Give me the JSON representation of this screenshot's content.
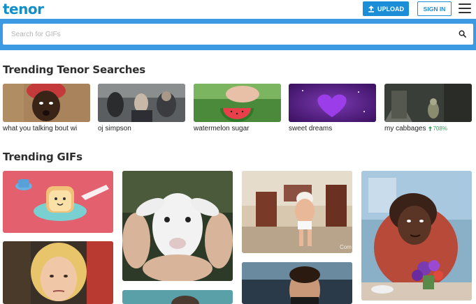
{
  "header": {
    "logo": "tenor",
    "upload_label": "UPLOAD",
    "signin_label": "SIGN IN"
  },
  "search": {
    "placeholder": "Search for GIFs"
  },
  "sections": {
    "trending_searches_title": "Trending Tenor Searches",
    "trending_gifs_title": "Trending GIFs"
  },
  "trending_searches": [
    {
      "label": "what you talking bout wi"
    },
    {
      "label": "oj simpson"
    },
    {
      "label": "watermelon sugar"
    },
    {
      "label": "sweet dreams"
    },
    {
      "label": "my cabbages",
      "trend": "708%"
    }
  ],
  "gif_watermark": "Com",
  "colors": {
    "brand": "#138fc8",
    "accent": "#1c8ed8",
    "search_band": "#3b9ae1",
    "trend_green": "#2aa44f"
  }
}
